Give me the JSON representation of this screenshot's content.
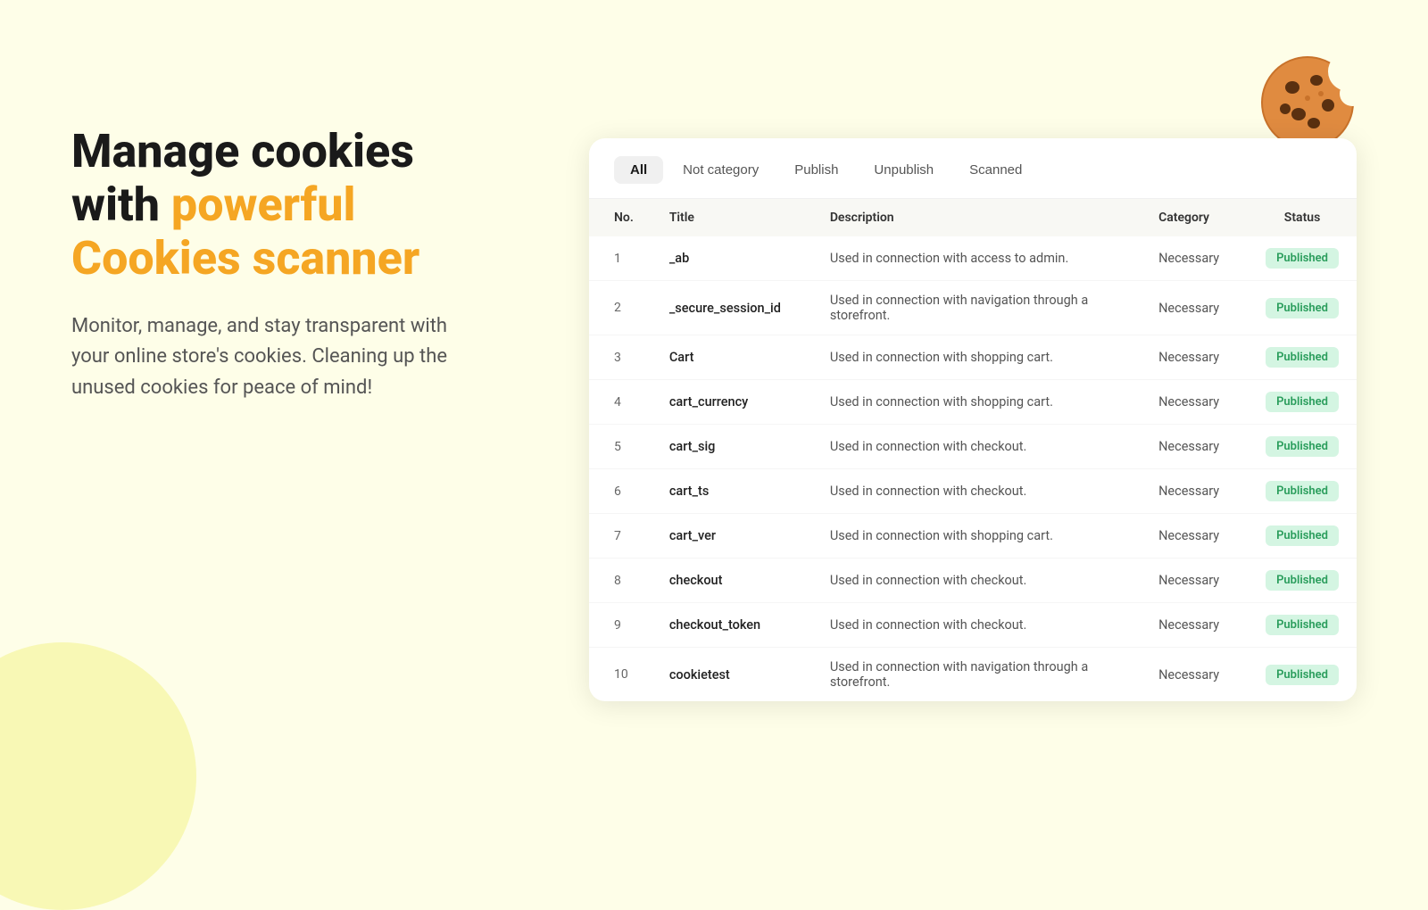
{
  "background_color": "#fefee8",
  "headline": {
    "line1": "Manage cookies",
    "line2_plain": "with ",
    "line2_highlight": "powerful",
    "line3": "Cookies scanner"
  },
  "subtext": "Monitor, manage, and stay transparent with your online store's cookies. Cleaning up the unused cookies for peace of mind!",
  "tabs": [
    {
      "label": "All",
      "active": true
    },
    {
      "label": "Not category",
      "active": false
    },
    {
      "label": "Publish",
      "active": false
    },
    {
      "label": "Unpublish",
      "active": false
    },
    {
      "label": "Scanned",
      "active": false
    }
  ],
  "table": {
    "columns": [
      "No.",
      "Title",
      "Description",
      "Category",
      "Status"
    ],
    "rows": [
      {
        "no": 1,
        "title": "_ab",
        "description": "Used in connection with access to admin.",
        "category": "Necessary",
        "status": "Published"
      },
      {
        "no": 2,
        "title": "_secure_session_id",
        "description": "Used in connection with navigation through a storefront.",
        "category": "Necessary",
        "status": "Published"
      },
      {
        "no": 3,
        "title": "Cart",
        "description": "Used in connection with shopping cart.",
        "category": "Necessary",
        "status": "Published"
      },
      {
        "no": 4,
        "title": "cart_currency",
        "description": "Used in connection with shopping cart.",
        "category": "Necessary",
        "status": "Published"
      },
      {
        "no": 5,
        "title": "cart_sig",
        "description": "Used in connection with checkout.",
        "category": "Necessary",
        "status": "Published"
      },
      {
        "no": 6,
        "title": "cart_ts",
        "description": "Used in connection with checkout.",
        "category": "Necessary",
        "status": "Published"
      },
      {
        "no": 7,
        "title": "cart_ver",
        "description": "Used in connection with shopping cart.",
        "category": "Necessary",
        "status": "Published"
      },
      {
        "no": 8,
        "title": "checkout",
        "description": "Used in connection with checkout.",
        "category": "Necessary",
        "status": "Published"
      },
      {
        "no": 9,
        "title": "checkout_token",
        "description": "Used in connection with checkout.",
        "category": "Necessary",
        "status": "Published"
      },
      {
        "no": 10,
        "title": "cookietest",
        "description": "Used in connection with navigation through a storefront.",
        "category": "Necessary",
        "status": "Published"
      }
    ]
  }
}
